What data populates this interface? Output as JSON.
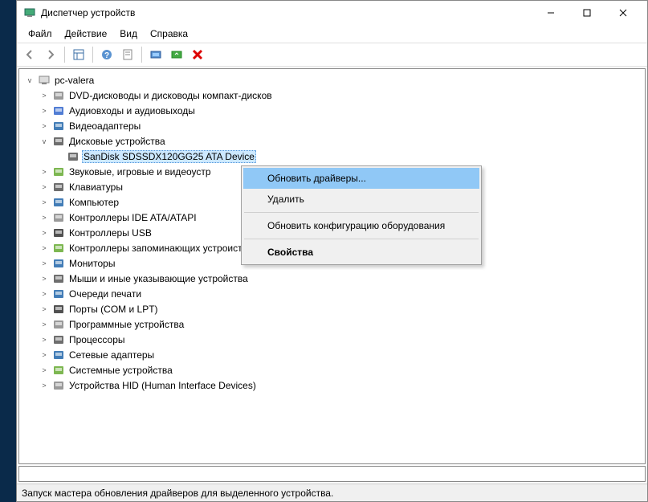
{
  "window": {
    "title": "Диспетчер устройств"
  },
  "menubar": {
    "file": "Файл",
    "action": "Действие",
    "view": "Вид",
    "help": "Справка"
  },
  "tree": {
    "root": "pc-valera",
    "items": [
      {
        "label": "DVD-дисководы и дисководы компакт-дисков",
        "icon": "disc"
      },
      {
        "label": "Аудиовходы и аудиовыходы",
        "icon": "audio"
      },
      {
        "label": "Видеоадаптеры",
        "icon": "display"
      },
      {
        "label": "Дисковые устройства",
        "icon": "disk",
        "expanded": true,
        "child": "SanDisk SDSSDX120GG25 ATA Device"
      },
      {
        "label": "Звуковые, игровые и видеоустр",
        "icon": "sound"
      },
      {
        "label": "Клавиатуры",
        "icon": "keyboard"
      },
      {
        "label": "Компьютер",
        "icon": "computer"
      },
      {
        "label": "Контроллеры IDE ATA/ATAPI",
        "icon": "ide"
      },
      {
        "label": "Контроллеры USB",
        "icon": "usb"
      },
      {
        "label": "Контроллеры запоминающих устроиств",
        "icon": "storage"
      },
      {
        "label": "Мониторы",
        "icon": "monitor"
      },
      {
        "label": "Мыши и иные указывающие устройства",
        "icon": "mouse"
      },
      {
        "label": "Очереди печати",
        "icon": "printer"
      },
      {
        "label": "Порты (COM и LPT)",
        "icon": "port"
      },
      {
        "label": "Программные устройства",
        "icon": "software"
      },
      {
        "label": "Процессоры",
        "icon": "cpu"
      },
      {
        "label": "Сетевые адаптеры",
        "icon": "network"
      },
      {
        "label": "Системные устройства",
        "icon": "system"
      },
      {
        "label": "Устройства HID (Human Interface Devices)",
        "icon": "hid"
      }
    ]
  },
  "context": {
    "update": "Обновить драйверы...",
    "delete": "Удалить",
    "refresh": "Обновить конфигурацию оборудования",
    "properties": "Свойства"
  },
  "statusbar": {
    "text": "Запуск мастера обновления драйверов для выделенного устройства."
  }
}
